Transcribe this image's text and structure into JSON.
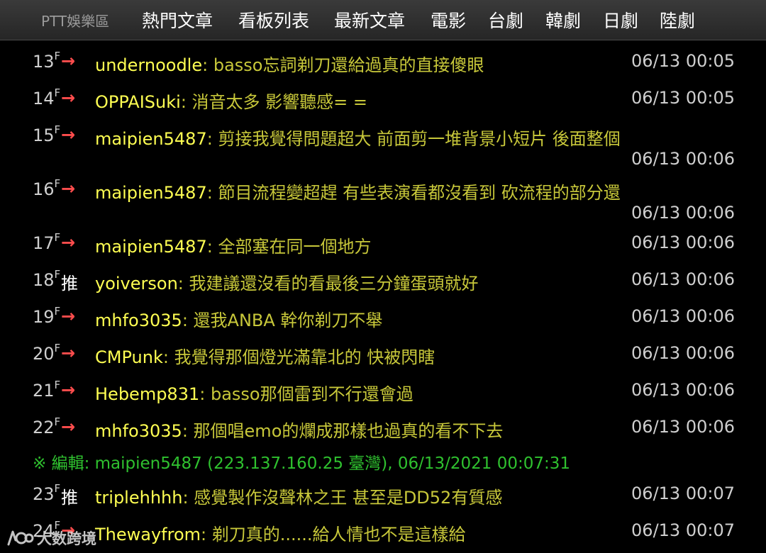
{
  "nav": {
    "brand": "PTT娛樂區",
    "links": [
      "熱門文章",
      "看板列表",
      "最新文章",
      "電影",
      "台劇",
      "韓劇",
      "日劇",
      "陸劇"
    ]
  },
  "comments": [
    {
      "floor": "13",
      "floor_mark": "F",
      "tag": "→",
      "user": "undernoodle",
      "text": "basso忘詞剃刀還給過真的直接傻眼",
      "time": "06/13 00:05"
    },
    {
      "floor": "14",
      "floor_mark": "F",
      "tag": "→",
      "user": "OPPAISuki",
      "text": "消音太多 影響聽感= =",
      "time": "06/13 00:05"
    },
    {
      "floor": "15",
      "floor_mark": "F",
      "tag": "→",
      "user": "maipien5487",
      "text": "剪接我覺得問題超大 前面剪一堆背景小短片 後面整個",
      "time": "06/13 00:06"
    },
    {
      "floor": "16",
      "floor_mark": "F",
      "tag": "→",
      "user": "maipien5487",
      "text": "節目流程變超趕 有些表演看都沒看到 砍流程的部分還",
      "time": "06/13 00:06"
    },
    {
      "floor": "17",
      "floor_mark": "F",
      "tag": "→",
      "user": "maipien5487",
      "text": "全部塞在同一個地方",
      "time": "06/13 00:06"
    },
    {
      "floor": "18",
      "floor_mark": "F",
      "tag": "推",
      "user": "yoiverson",
      "text": "我建議還沒看的看最後三分鐘蛋頭就好",
      "time": "06/13 00:06"
    },
    {
      "floor": "19",
      "floor_mark": "F",
      "tag": "→",
      "user": "mhfo3035",
      "text": "還我ANBA 幹你剃刀不舉",
      "time": "06/13 00:06"
    },
    {
      "floor": "20",
      "floor_mark": "F",
      "tag": "→",
      "user": "CMPunk",
      "text": "我覺得那個燈光滿靠北的 快被閃瞎",
      "time": "06/13 00:06"
    },
    {
      "floor": "21",
      "floor_mark": "F",
      "tag": "→",
      "user": "Hebemp831",
      "text": "basso那個雷到不行還會過",
      "time": "06/13 00:06"
    },
    {
      "floor": "22",
      "floor_mark": "F",
      "tag": "→",
      "user": "mhfo3035",
      "text": "那個唱emo的爛成那樣也過真的看不下去",
      "time": "06/13 00:06"
    },
    {
      "floor": "23",
      "floor_mark": "F",
      "tag": "推",
      "user": "triplehhhh",
      "text": "感覺製作沒聲林之王 甚至是DD52有質感",
      "time": "06/13 00:07"
    },
    {
      "floor": "24",
      "floor_mark": "F",
      "tag": "→",
      "user": "Thewayfrom",
      "text": "剃刀真的......給人情也不是這樣給",
      "time": "06/13 00:07"
    }
  ],
  "colon": ":",
  "edit_note": "※ 編輯: maipien5487 (223.137.160.25 臺灣), 06/13/2021 00:07:31",
  "watermark": "大数跨境",
  "colors": {
    "background": "#000000",
    "user": "#ffff52",
    "message": "#c8c83a",
    "arrow": "#ff4d4d",
    "edit_note": "#2fc12f"
  }
}
